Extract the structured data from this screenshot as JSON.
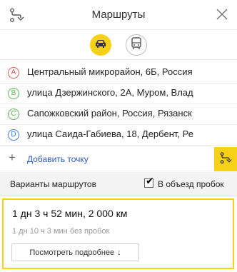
{
  "header": {
    "title": "Маршруты"
  },
  "modes": {
    "car_icon": "car-icon",
    "bus_icon": "bus-icon",
    "active": "car",
    "accent_color": "#f7d117"
  },
  "waypoints": [
    {
      "letter": "A",
      "text": "Центральный микрорайон, 6Б, Россия"
    },
    {
      "letter": "B",
      "text": "улица Дзержинского, 2А, Муром, Влад"
    },
    {
      "letter": "C",
      "text": "Сапожковский район, Россия, Рязанск"
    },
    {
      "letter": "D",
      "text": "улица Саида-Габиева, 18, Дербент, Ре"
    }
  ],
  "add_point": {
    "plus": "+",
    "label": "Добавить точку"
  },
  "options": {
    "variants_label": "Варианты маршрутов",
    "avoid_traffic_label": "В объезд пробок",
    "avoid_traffic_checked": true,
    "check_mark": "✔"
  },
  "result": {
    "duration_distance": "1 дн 3 ч 52 мин, 2 000 км",
    "without_traffic": "1 дн 10 ч 3 мин без пробок",
    "details_label": "Посмотреть подробнее",
    "details_arrow": "↓"
  }
}
